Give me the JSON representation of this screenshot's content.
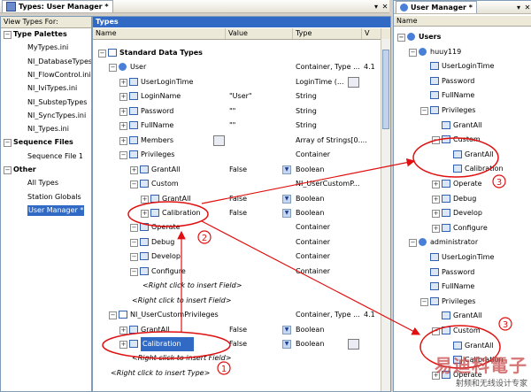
{
  "window": {
    "title": "Types: User Manager *"
  },
  "left": {
    "header": "View Types For:",
    "items": [
      {
        "label": "Type Palettes",
        "bold": true,
        "level": 0
      },
      {
        "label": "MyTypes.ini",
        "level": 1
      },
      {
        "label": "NI_DatabaseTypes",
        "level": 1
      },
      {
        "label": "NI_FlowControl.ini",
        "level": 1
      },
      {
        "label": "NI_IviTypes.ini",
        "level": 1
      },
      {
        "label": "NI_SubstepTypes",
        "level": 1
      },
      {
        "label": "NI_SyncTypes.ini",
        "level": 1
      },
      {
        "label": "NI_Types.ini",
        "level": 1
      },
      {
        "label": "Sequence Files",
        "bold": true,
        "level": 0
      },
      {
        "label": "Sequence File 1",
        "level": 1
      },
      {
        "label": "Other",
        "bold": true,
        "level": 0
      },
      {
        "label": "All Types",
        "level": 1
      },
      {
        "label": "Station Globals",
        "level": 1
      },
      {
        "label": "User Manager *",
        "level": 1,
        "selected": true
      }
    ]
  },
  "main": {
    "header": "Types",
    "columns": {
      "name": "Name",
      "value": "Value",
      "type": "Type",
      "ver": "V"
    },
    "rows": [
      {
        "name": "Standard Data Types",
        "indent": 0,
        "bold": true,
        "icon": "struct",
        "value": "",
        "type": "",
        "ver": ""
      },
      {
        "name": "User",
        "indent": 1,
        "icon": "user",
        "value": "",
        "type": "Container, Type ...",
        "ver": "4.1"
      },
      {
        "name": "UserLoginTime",
        "indent": 2,
        "icon": "field",
        "value": "",
        "type": "LoginTime (...",
        "ver": ""
      },
      {
        "name": "LoginName",
        "indent": 2,
        "icon": "field",
        "value": "\"User\"",
        "type": "String",
        "ver": ""
      },
      {
        "name": "Password",
        "indent": 2,
        "icon": "field",
        "value": "\"\"",
        "type": "String",
        "ver": ""
      },
      {
        "name": "FullName",
        "indent": 2,
        "icon": "field",
        "value": "\"\"",
        "type": "String",
        "ver": ""
      },
      {
        "name": "Members",
        "indent": 2,
        "icon": "field",
        "value": "",
        "type": "Array of Strings[0....",
        "ver": ""
      },
      {
        "name": "Privileges",
        "indent": 2,
        "icon": "field",
        "value": "",
        "type": "Container",
        "ver": ""
      },
      {
        "name": "GrantAll",
        "indent": 3,
        "icon": "field",
        "value": "False",
        "type": "Boolean",
        "ver": ""
      },
      {
        "name": "Custom",
        "indent": 3,
        "icon": "field",
        "value": "",
        "type": "NI_UserCustomP...",
        "ver": ""
      },
      {
        "name": "GrantAll",
        "indent": 4,
        "icon": "field",
        "value": "False",
        "type": "Boolean",
        "ver": ""
      },
      {
        "name": "Calibration",
        "indent": 4,
        "icon": "field",
        "value": "False",
        "type": "Boolean",
        "ver": ""
      },
      {
        "name": "Operate",
        "indent": 3,
        "icon": "field",
        "value": "",
        "type": "Container",
        "ver": ""
      },
      {
        "name": "Debug",
        "indent": 3,
        "icon": "field",
        "value": "",
        "type": "Container",
        "ver": ""
      },
      {
        "name": "Develop",
        "indent": 3,
        "icon": "field",
        "value": "",
        "type": "Container",
        "ver": ""
      },
      {
        "name": "Configure",
        "indent": 3,
        "icon": "field",
        "value": "",
        "type": "Container",
        "ver": ""
      },
      {
        "name": "<Right click to insert Field>",
        "indent": 3,
        "italic": true,
        "value": "",
        "type": "",
        "ver": ""
      },
      {
        "name": "<Right click to insert Field>",
        "indent": 2,
        "italic": true,
        "value": "",
        "type": "",
        "ver": ""
      },
      {
        "name": "NI_UserCustomPrivileges",
        "indent": 1,
        "icon": "struct",
        "value": "",
        "type": "Container, Type ...",
        "ver": "4.1"
      },
      {
        "name": "GrantAll",
        "indent": 2,
        "icon": "field",
        "value": "False",
        "type": "Boolean",
        "ver": ""
      },
      {
        "name": "Calibration",
        "indent": 2,
        "icon": "field",
        "value": "False",
        "type": "Boolean",
        "ver": "",
        "selected": true
      },
      {
        "name": "<Right click to insert Field>",
        "indent": 2,
        "italic": true,
        "value": "",
        "type": "",
        "ver": ""
      },
      {
        "name": "<Right click to insert Type>",
        "indent": 0,
        "italic": true,
        "value": "",
        "type": "",
        "ver": ""
      }
    ]
  },
  "right": {
    "title": "User Manager *",
    "column": "Name",
    "rows": [
      {
        "label": "Users",
        "indent": 0,
        "bold": true
      },
      {
        "label": "huuy119",
        "indent": 1
      },
      {
        "label": "UserLoginTime",
        "indent": 2
      },
      {
        "label": "Password",
        "indent": 2
      },
      {
        "label": "FullName",
        "indent": 2
      },
      {
        "label": "Privileges",
        "indent": 2
      },
      {
        "label": "GrantAll",
        "indent": 3
      },
      {
        "label": "Custom",
        "indent": 3
      },
      {
        "label": "GrantAll",
        "indent": 4
      },
      {
        "label": "Calibration",
        "indent": 4
      },
      {
        "label": "Operate",
        "indent": 3
      },
      {
        "label": "Debug",
        "indent": 3
      },
      {
        "label": "Develop",
        "indent": 3
      },
      {
        "label": "Configure",
        "indent": 3
      },
      {
        "label": "administrator",
        "indent": 1
      },
      {
        "label": "UserLoginTime",
        "indent": 2
      },
      {
        "label": "Password",
        "indent": 2
      },
      {
        "label": "FullName",
        "indent": 2
      },
      {
        "label": "Privileges",
        "indent": 2
      },
      {
        "label": "GrantAll",
        "indent": 3
      },
      {
        "label": "Custom",
        "indent": 3
      },
      {
        "label": "GrantAll",
        "indent": 4
      },
      {
        "label": "Calibration",
        "indent": 4
      },
      {
        "label": "Operate",
        "indent": 3
      }
    ]
  },
  "annotations": {
    "n1": "1",
    "n2": "2",
    "n3a": "3",
    "n3b": "3"
  },
  "watermark": {
    "big": "易迪科電子",
    "small": "射频和无线设计专家"
  },
  "colors": {
    "accent": "#316ac5",
    "annotation": "#e01010"
  }
}
